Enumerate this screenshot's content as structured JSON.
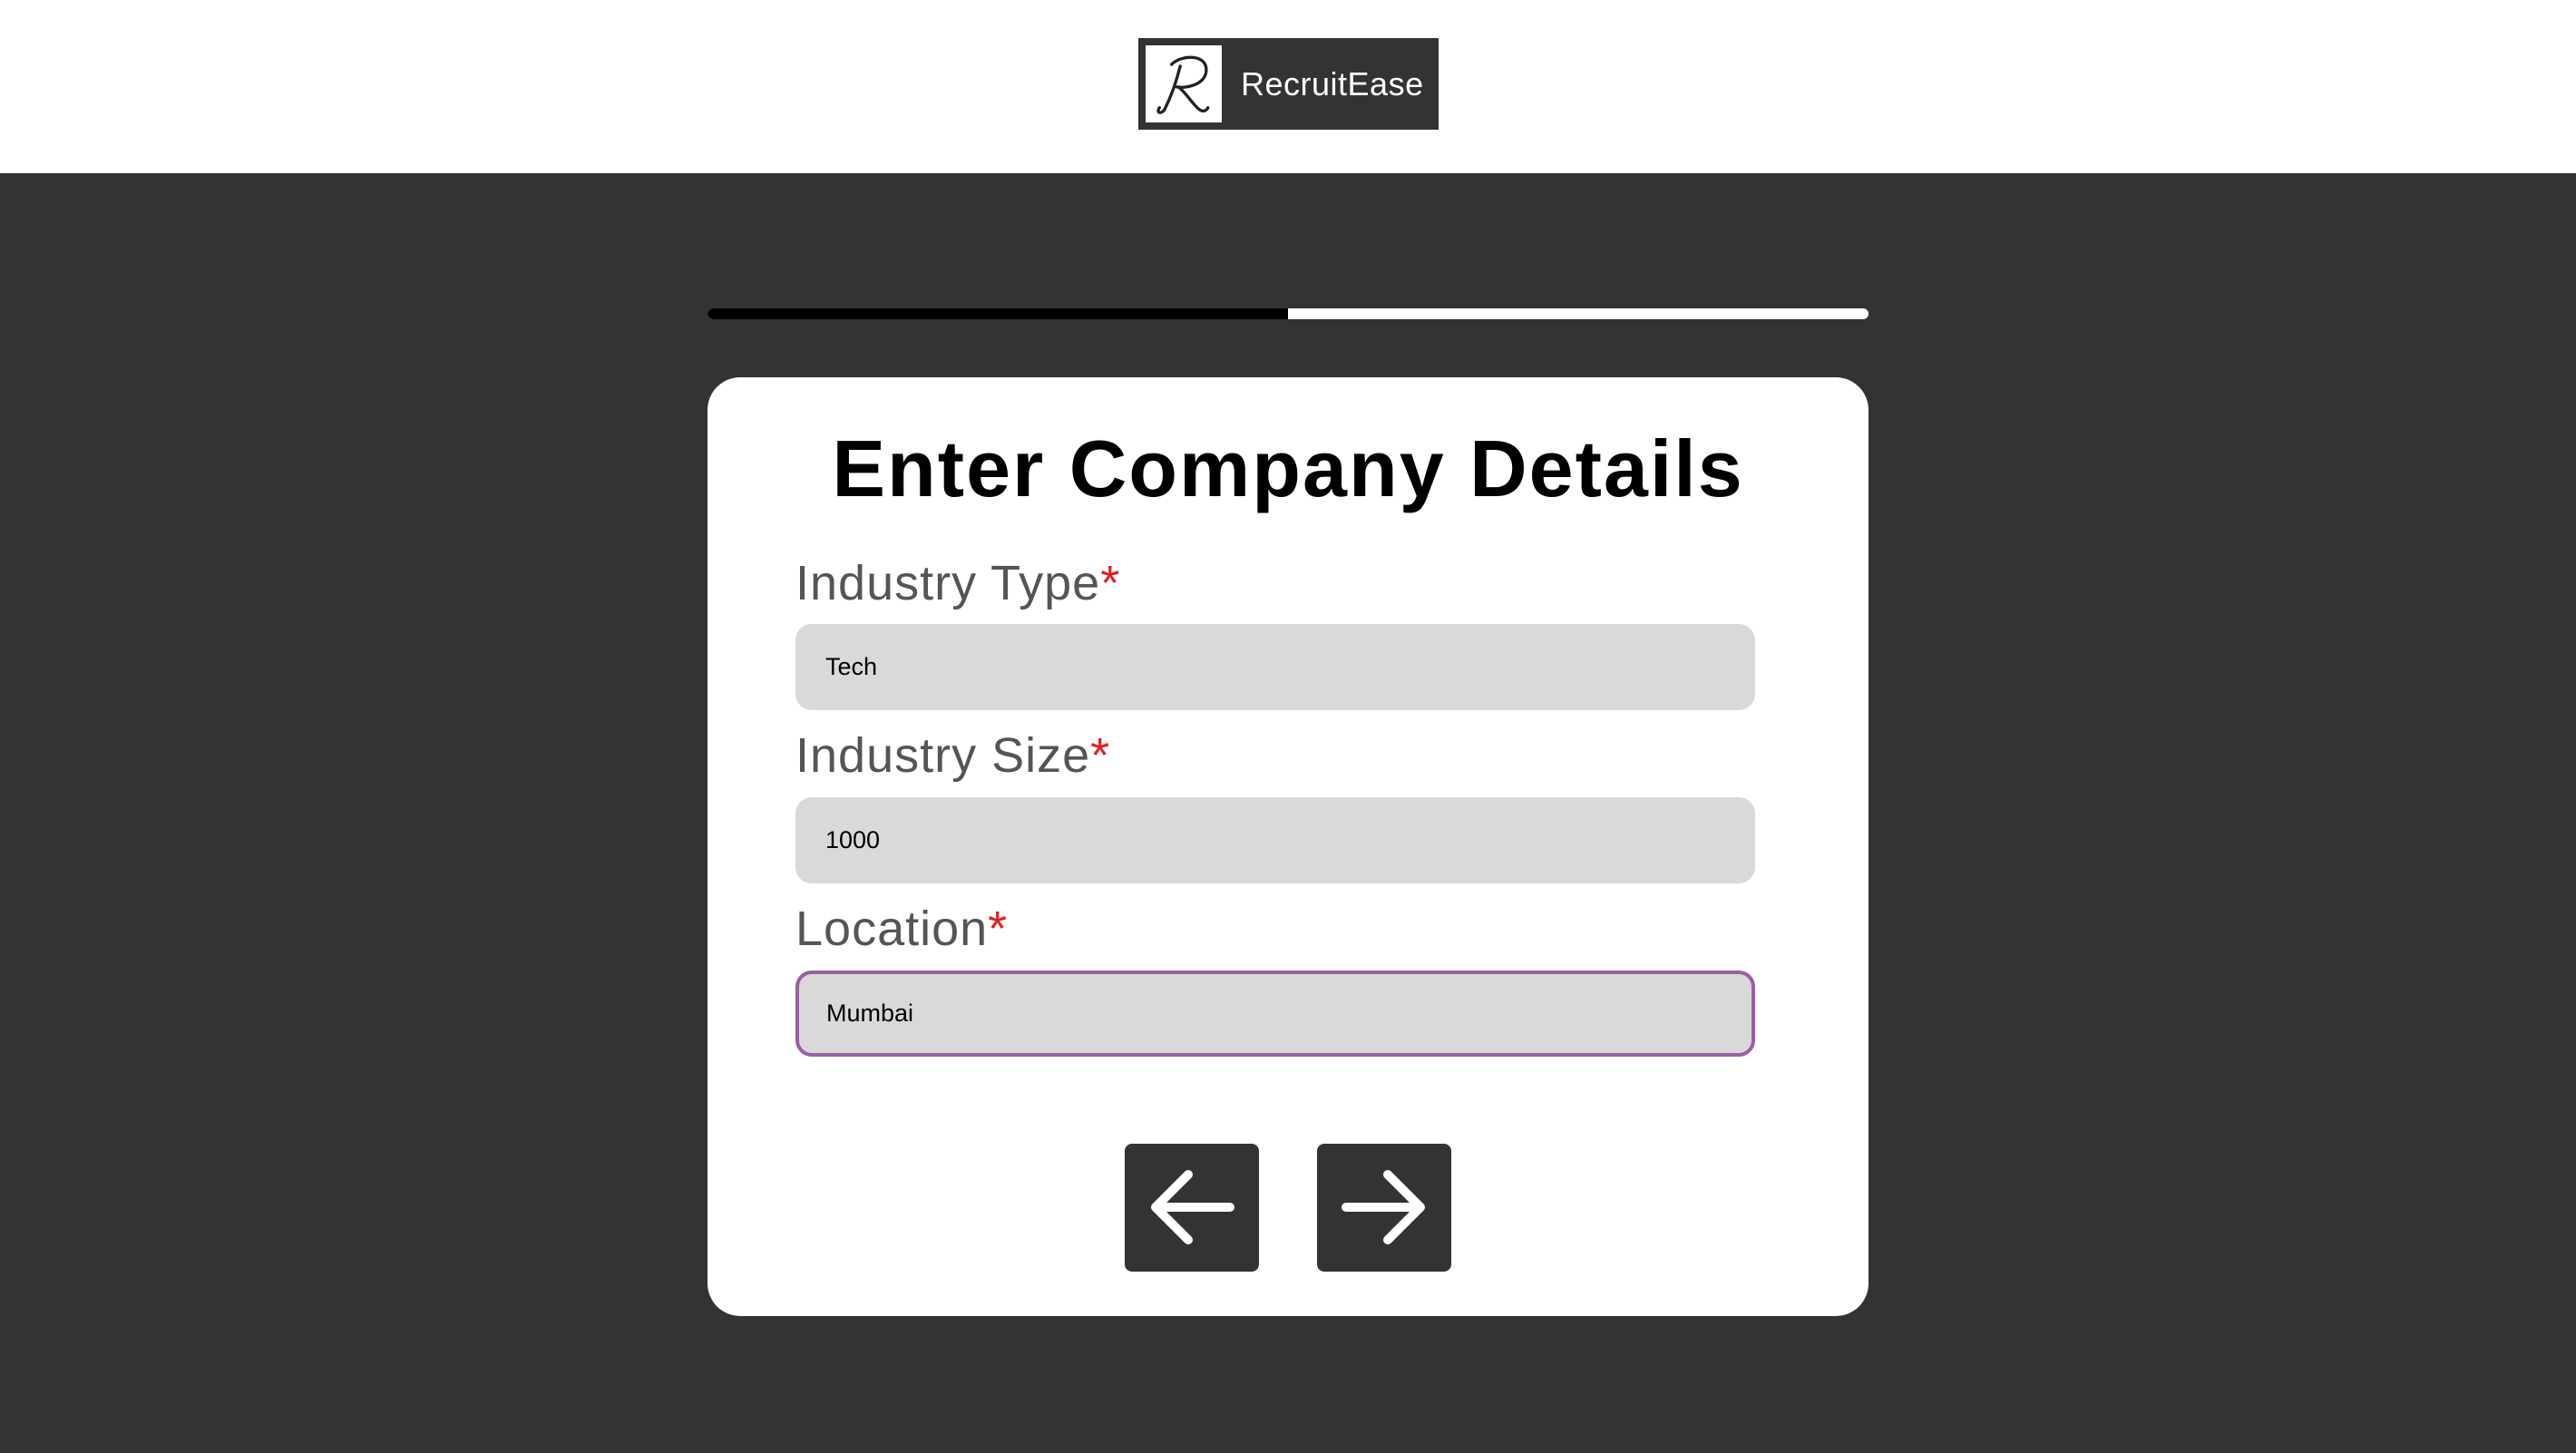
{
  "header": {
    "brand_name": "RecruitEase",
    "logo_letter_icon": "script-r-icon"
  },
  "progress": {
    "value": 0.5
  },
  "form": {
    "title": "Enter Company Details",
    "required_marker": "*",
    "fields": [
      {
        "label": "Industry Type",
        "value": "Tech"
      },
      {
        "label": "Industry Size",
        "value": "1000"
      },
      {
        "label": "Location",
        "value": "Mumbai"
      }
    ],
    "back_icon": "arrow-left-icon",
    "next_icon": "arrow-right-icon"
  },
  "colors": {
    "page_background": "#333333",
    "card_background": "#ffffff",
    "input_background": "#d9d9d9",
    "focus_border": "#9b5fa5",
    "required_marker": "#e02020",
    "progress_fill": "#000000",
    "progress_track": "#ffffff"
  }
}
